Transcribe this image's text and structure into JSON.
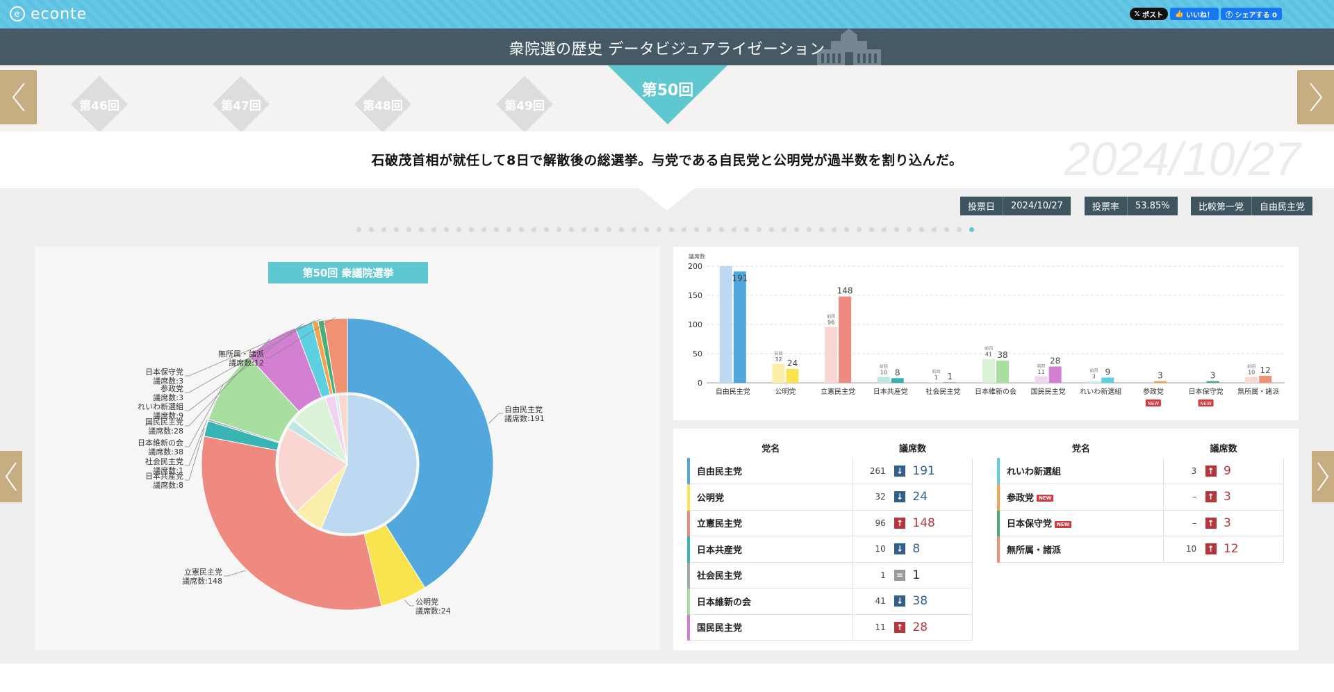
{
  "site": {
    "logo": "econte",
    "logo_mark": "e"
  },
  "social": {
    "post": "ポスト",
    "like": "いいね！",
    "share": "シェアする 0"
  },
  "header": {
    "title": "衆院選の歴史 データビジュアライゼーション"
  },
  "nav": {
    "rounds": [
      "第46回",
      "第47回",
      "第48回",
      "第49回"
    ],
    "current": "第50回",
    "prev_icon": "chevron-left-icon",
    "next_icon": "chevron-right-icon"
  },
  "headline": "石破茂首相が就任して8日で解散後の総選挙。与党である自民党と公明党が過半数を割り込んだ。",
  "big_date": "2024/10/27",
  "info": {
    "vote_date_label": "投票日",
    "vote_date": "2024/10/27",
    "turnout_label": "投票率",
    "turnout": "53.85%",
    "top_party_label": "比較第一党",
    "top_party": "自由民主党"
  },
  "timeline": {
    "count": 50,
    "active_index": 49
  },
  "colors": {
    "accent": "#5fc7d0",
    "header": "#465a66",
    "topbar": "#5bc2e2",
    "nav_gold": "#c6ad82",
    "up": "#b5353b",
    "down": "#2f5f8a"
  },
  "chart_data": [
    {
      "type": "pie",
      "title": "第50回 衆議院選挙",
      "label_suffix": "議席数:",
      "outer_series": [
        {
          "name": "自由民主党",
          "value": 191,
          "color": "#52a8dc"
        },
        {
          "name": "公明党",
          "value": 24,
          "color": "#f9e34f"
        },
        {
          "name": "立憲民主党",
          "value": 148,
          "color": "#ef8a80"
        },
        {
          "name": "日本共産党",
          "value": 8,
          "color": "#38b4b2"
        },
        {
          "name": "社会民主党",
          "value": 1,
          "color": "#9fa9ae"
        },
        {
          "name": "日本維新の会",
          "value": 38,
          "color": "#a8dfa0"
        },
        {
          "name": "国民民主党",
          "value": 28,
          "color": "#d37fd2"
        },
        {
          "name": "れいわ新選組",
          "value": 9,
          "color": "#5ccfe0"
        },
        {
          "name": "参政党",
          "value": 3,
          "color": "#f4a34e"
        },
        {
          "name": "日本保守党",
          "value": 3,
          "color": "#4aae7a"
        },
        {
          "name": "無所属・諸派",
          "value": 12,
          "color": "#f09174"
        }
      ],
      "inner_series": [
        {
          "name": "自由民主党",
          "value": 261,
          "color": "#bcd9f1"
        },
        {
          "name": "公明党",
          "value": 32,
          "color": "#fbeeaa"
        },
        {
          "name": "立憲民主党",
          "value": 96,
          "color": "#fad6d2"
        },
        {
          "name": "日本共産党",
          "value": 10,
          "color": "#bde6e5"
        },
        {
          "name": "社会民主党",
          "value": 1,
          "color": "#dde1e3"
        },
        {
          "name": "日本維新の会",
          "value": 41,
          "color": "#daf2d6"
        },
        {
          "name": "国民民主党",
          "value": 11,
          "color": "#f0d3ef"
        },
        {
          "name": "れいわ新選組",
          "value": 3,
          "color": "#c9eff5"
        },
        {
          "name": "無所属・諸派",
          "value": 10,
          "color": "#fad8cd"
        }
      ]
    },
    {
      "type": "bar",
      "ylabel": "議席数",
      "ylim": [
        0,
        200
      ],
      "yticks": [
        0,
        50,
        100,
        150,
        200
      ],
      "prev_label": "前回",
      "categories": [
        "自由民主党",
        "公明党",
        "立憲民主党",
        "日本共産党",
        "社会民主党",
        "日本維新の会",
        "国民民主党",
        "れいわ新選組",
        "参政党",
        "日本保守党",
        "無所属・諸派"
      ],
      "new_flags": [
        false,
        false,
        false,
        false,
        false,
        false,
        false,
        false,
        true,
        true,
        false
      ],
      "prev": [
        261,
        32,
        96,
        10,
        1,
        41,
        11,
        3,
        null,
        null,
        10
      ],
      "current": [
        191,
        24,
        148,
        8,
        1,
        38,
        28,
        9,
        3,
        3,
        12
      ],
      "prev_colors": [
        "#bcd9f1",
        "#fbeeaa",
        "#fad6d2",
        "#bde6e5",
        "#dde1e3",
        "#daf2d6",
        "#f0d3ef",
        "#c9eff5",
        "#fbd9b5",
        "#bde6d0",
        "#fad8cd"
      ],
      "cur_colors": [
        "#52a8dc",
        "#f9e34f",
        "#ef8a80",
        "#38b4b2",
        "#9fa9ae",
        "#a8dfa0",
        "#d37fd2",
        "#5ccfe0",
        "#f4a34e",
        "#4aae7a",
        "#f09174"
      ]
    }
  ],
  "table": {
    "col_party": "党名",
    "col_seats": "議席数",
    "new_badge": "NEW",
    "left": [
      {
        "party": "自由民主党",
        "prev": "261",
        "trend": "down",
        "seats": "191",
        "color": "#52a8dc"
      },
      {
        "party": "公明党",
        "prev": "32",
        "trend": "down",
        "seats": "24",
        "color": "#f9e34f"
      },
      {
        "party": "立憲民主党",
        "prev": "96",
        "trend": "up",
        "seats": "148",
        "color": "#ef8a80"
      },
      {
        "party": "日本共産党",
        "prev": "10",
        "trend": "down",
        "seats": "8",
        "color": "#38b4b2"
      },
      {
        "party": "社会民主党",
        "prev": "1",
        "trend": "eq",
        "seats": "1",
        "color": "#9fa9ae"
      },
      {
        "party": "日本維新の会",
        "prev": "41",
        "trend": "down",
        "seats": "38",
        "color": "#a8dfa0"
      },
      {
        "party": "国民民主党",
        "prev": "11",
        "trend": "up",
        "seats": "28",
        "color": "#d37fd2"
      }
    ],
    "right": [
      {
        "party": "れいわ新選組",
        "prev": "3",
        "trend": "up",
        "seats": "9",
        "color": "#5ccfe0",
        "is_new": false
      },
      {
        "party": "参政党",
        "prev": "–",
        "trend": "up",
        "seats": "3",
        "color": "#f4a34e",
        "is_new": true
      },
      {
        "party": "日本保守党",
        "prev": "–",
        "trend": "up",
        "seats": "3",
        "color": "#4aae7a",
        "is_new": true
      },
      {
        "party": "無所属・諸派",
        "prev": "10",
        "trend": "up",
        "seats": "12",
        "color": "#f09174",
        "is_new": false
      }
    ]
  }
}
